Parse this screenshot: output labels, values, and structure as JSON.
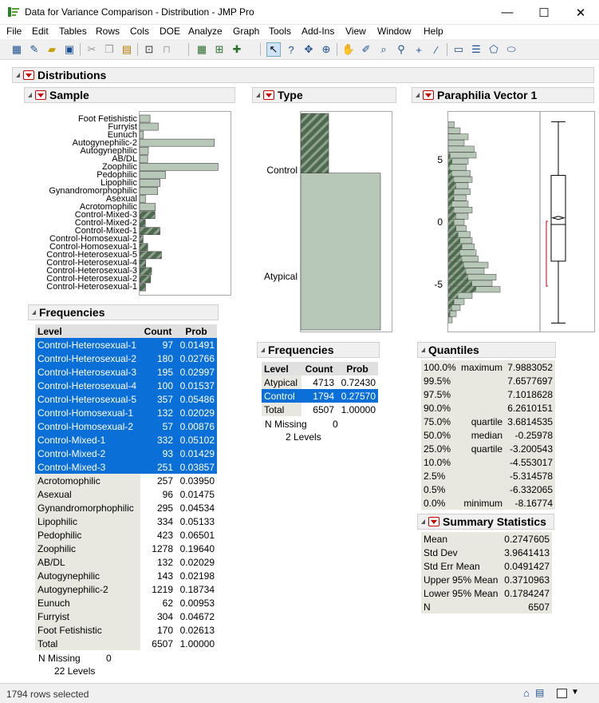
{
  "window": {
    "title": "Data for Variance Comparison - Distribution - JMP Pro",
    "minimize": "—",
    "maximize": "☐",
    "close": "✕"
  },
  "menu": [
    "File",
    "Edit",
    "Tables",
    "Rows",
    "Cols",
    "DOE",
    "Analyze",
    "Graph",
    "Tools",
    "Add-Ins",
    "View",
    "Window",
    "Help"
  ],
  "distributions_title": "Distributions",
  "sample": {
    "title": "Sample",
    "levels": [
      "Foot Fetishistic",
      "Furryist",
      "Eunuch",
      "Autogynephilic-2",
      "Autogynephilic",
      "AB/DL",
      "Zoophilic",
      "Pedophilic",
      "Lipophilic",
      "Gynandromorphophilic",
      "Asexual",
      "Acrotomophilic",
      "Control-Mixed-3",
      "Control-Mixed-2",
      "Control-Mixed-1",
      "Control-Homosexual-2",
      "Control-Homosexual-1",
      "Control-Heterosexual-5",
      "Control-Heterosexual-4",
      "Control-Heterosexual-3",
      "Control-Heterosexual-2",
      "Control-Heterosexual-1"
    ],
    "counts": [
      170,
      304,
      62,
      1219,
      143,
      132,
      1278,
      423,
      334,
      295,
      96,
      257,
      251,
      93,
      332,
      57,
      132,
      357,
      100,
      195,
      180,
      97
    ],
    "selected": [
      false,
      false,
      false,
      false,
      false,
      false,
      false,
      false,
      false,
      false,
      false,
      false,
      true,
      true,
      true,
      true,
      true,
      true,
      true,
      true,
      true,
      true
    ],
    "freq_title": "Frequencies",
    "columns": [
      "Level",
      "Count",
      "Prob"
    ],
    "rows": [
      [
        "Control-Heterosexual-1",
        "97",
        "0.01491"
      ],
      [
        "Control-Heterosexual-2",
        "180",
        "0.02766"
      ],
      [
        "Control-Heterosexual-3",
        "195",
        "0.02997"
      ],
      [
        "Control-Heterosexual-4",
        "100",
        "0.01537"
      ],
      [
        "Control-Heterosexual-5",
        "357",
        "0.05486"
      ],
      [
        "Control-Homosexual-1",
        "132",
        "0.02029"
      ],
      [
        "Control-Homosexual-2",
        "57",
        "0.00876"
      ],
      [
        "Control-Mixed-1",
        "332",
        "0.05102"
      ],
      [
        "Control-Mixed-2",
        "93",
        "0.01429"
      ],
      [
        "Control-Mixed-3",
        "251",
        "0.03857"
      ],
      [
        "Acrotomophilic",
        "257",
        "0.03950"
      ],
      [
        "Asexual",
        "96",
        "0.01475"
      ],
      [
        "Gynandromorphophilic",
        "295",
        "0.04534"
      ],
      [
        "Lipophilic",
        "334",
        "0.05133"
      ],
      [
        "Pedophilic",
        "423",
        "0.06501"
      ],
      [
        "Zoophilic",
        "1278",
        "0.19640"
      ],
      [
        "AB/DL",
        "132",
        "0.02029"
      ],
      [
        "Autogynephilic",
        "143",
        "0.02198"
      ],
      [
        "Autogynephilic-2",
        "1219",
        "0.18734"
      ],
      [
        "Eunuch",
        "62",
        "0.00953"
      ],
      [
        "Furryist",
        "304",
        "0.04672"
      ],
      [
        "Foot Fetishistic",
        "170",
        "0.02613"
      ]
    ],
    "total": [
      "Total",
      "6507",
      "1.00000"
    ],
    "n_missing_label": "N Missing",
    "n_missing": "0",
    "levels_text": "22  Levels"
  },
  "type": {
    "title": "Type",
    "labels": [
      "Control",
      "Atypical"
    ],
    "freq_title": "Frequencies",
    "columns": [
      "Level",
      "Count",
      "Prob"
    ],
    "rows": [
      [
        "Atypical",
        "4713",
        "0.72430"
      ],
      [
        "Control",
        "1794",
        "0.27570"
      ]
    ],
    "total": [
      "Total",
      "6507",
      "1.00000"
    ],
    "n_missing_label": "N Missing",
    "n_missing": "0",
    "levels_text": "2  Levels",
    "fractions": [
      0.2757,
      0.7243
    ]
  },
  "vector": {
    "title": "Paraphilia Vector 1",
    "ticks": [
      "5",
      "0",
      "-5"
    ],
    "quantiles_title": "Quantiles",
    "quantiles": [
      [
        "100.0%",
        "maximum",
        "7.9883052"
      ],
      [
        "99.5%",
        "",
        "7.6577697"
      ],
      [
        "97.5%",
        "",
        "7.1018628"
      ],
      [
        "90.0%",
        "",
        "6.2610151"
      ],
      [
        "75.0%",
        "quartile",
        "3.6814535"
      ],
      [
        "50.0%",
        "median",
        "-0.25978"
      ],
      [
        "25.0%",
        "quartile",
        "-3.200543"
      ],
      [
        "10.0%",
        "",
        "-4.553017"
      ],
      [
        "2.5%",
        "",
        "-5.314578"
      ],
      [
        "0.5%",
        "",
        "-6.332065"
      ],
      [
        "0.0%",
        "minimum",
        "-8.16774"
      ]
    ],
    "summary_title": "Summary Statistics",
    "summary": [
      [
        "Mean",
        "0.2747605"
      ],
      [
        "Std Dev",
        "3.9641413"
      ],
      [
        "Std Err Mean",
        "0.0491427"
      ],
      [
        "Upper 95% Mean",
        "0.3710963"
      ],
      [
        "Lower 95% Mean",
        "0.1784247"
      ],
      [
        "N",
        "6507"
      ]
    ],
    "hist_total": [
      3,
      6,
      10,
      8,
      13,
      14,
      10,
      9,
      11,
      12,
      10,
      11,
      9,
      10,
      12,
      10,
      8,
      9,
      11,
      12,
      13,
      14,
      15,
      20,
      18,
      24,
      22,
      26,
      12,
      8,
      6,
      4,
      2
    ],
    "hist_sel": [
      0,
      0,
      0,
      0,
      0,
      1,
      2,
      1,
      2,
      3,
      4,
      3,
      3,
      2,
      3,
      4,
      3,
      4,
      5,
      6,
      7,
      6,
      7,
      8,
      9,
      10,
      12,
      14,
      5,
      3,
      2,
      1,
      0
    ]
  },
  "status": {
    "text": "1794 rows selected"
  }
}
